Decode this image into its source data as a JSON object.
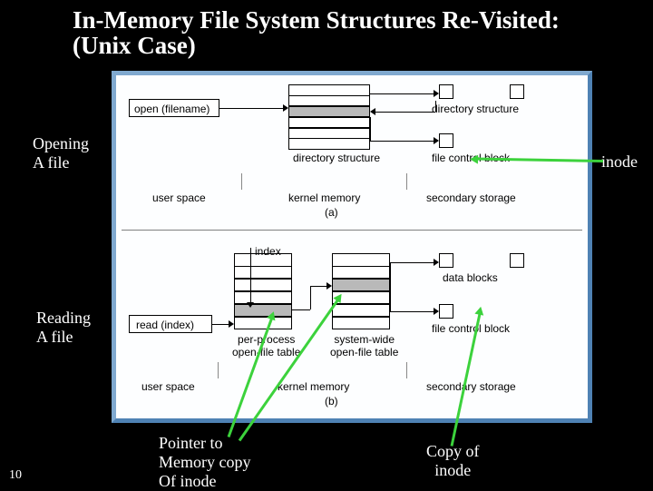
{
  "title": "In-Memory File System Structures Re-Visited: (Unix Case)",
  "page_number": "10",
  "overlay_labels": {
    "opening": "Opening\nA file",
    "reading": "Reading\nA file",
    "inode": "inode",
    "pointer": "Pointer to\nMemory copy\nOf inode",
    "copyof": "Copy of\ninode"
  },
  "diagram_a": {
    "op": "open (filename)",
    "center": "directory structure",
    "right_top": "directory structure",
    "right_bot": "file control block",
    "col1": "user space",
    "col2": "kernel memory",
    "col3": "secondary storage",
    "tag": "(a)"
  },
  "diagram_b": {
    "op": "read (index)",
    "idx": "index",
    "c1": "per-process\nopen-file table",
    "c2": "system-wide\nopen-file table",
    "right_top": "data blocks",
    "right_bot": "file control block",
    "col1": "user space",
    "col2": "kernel memory",
    "col3": "secondary storage",
    "tag": "(b)"
  }
}
